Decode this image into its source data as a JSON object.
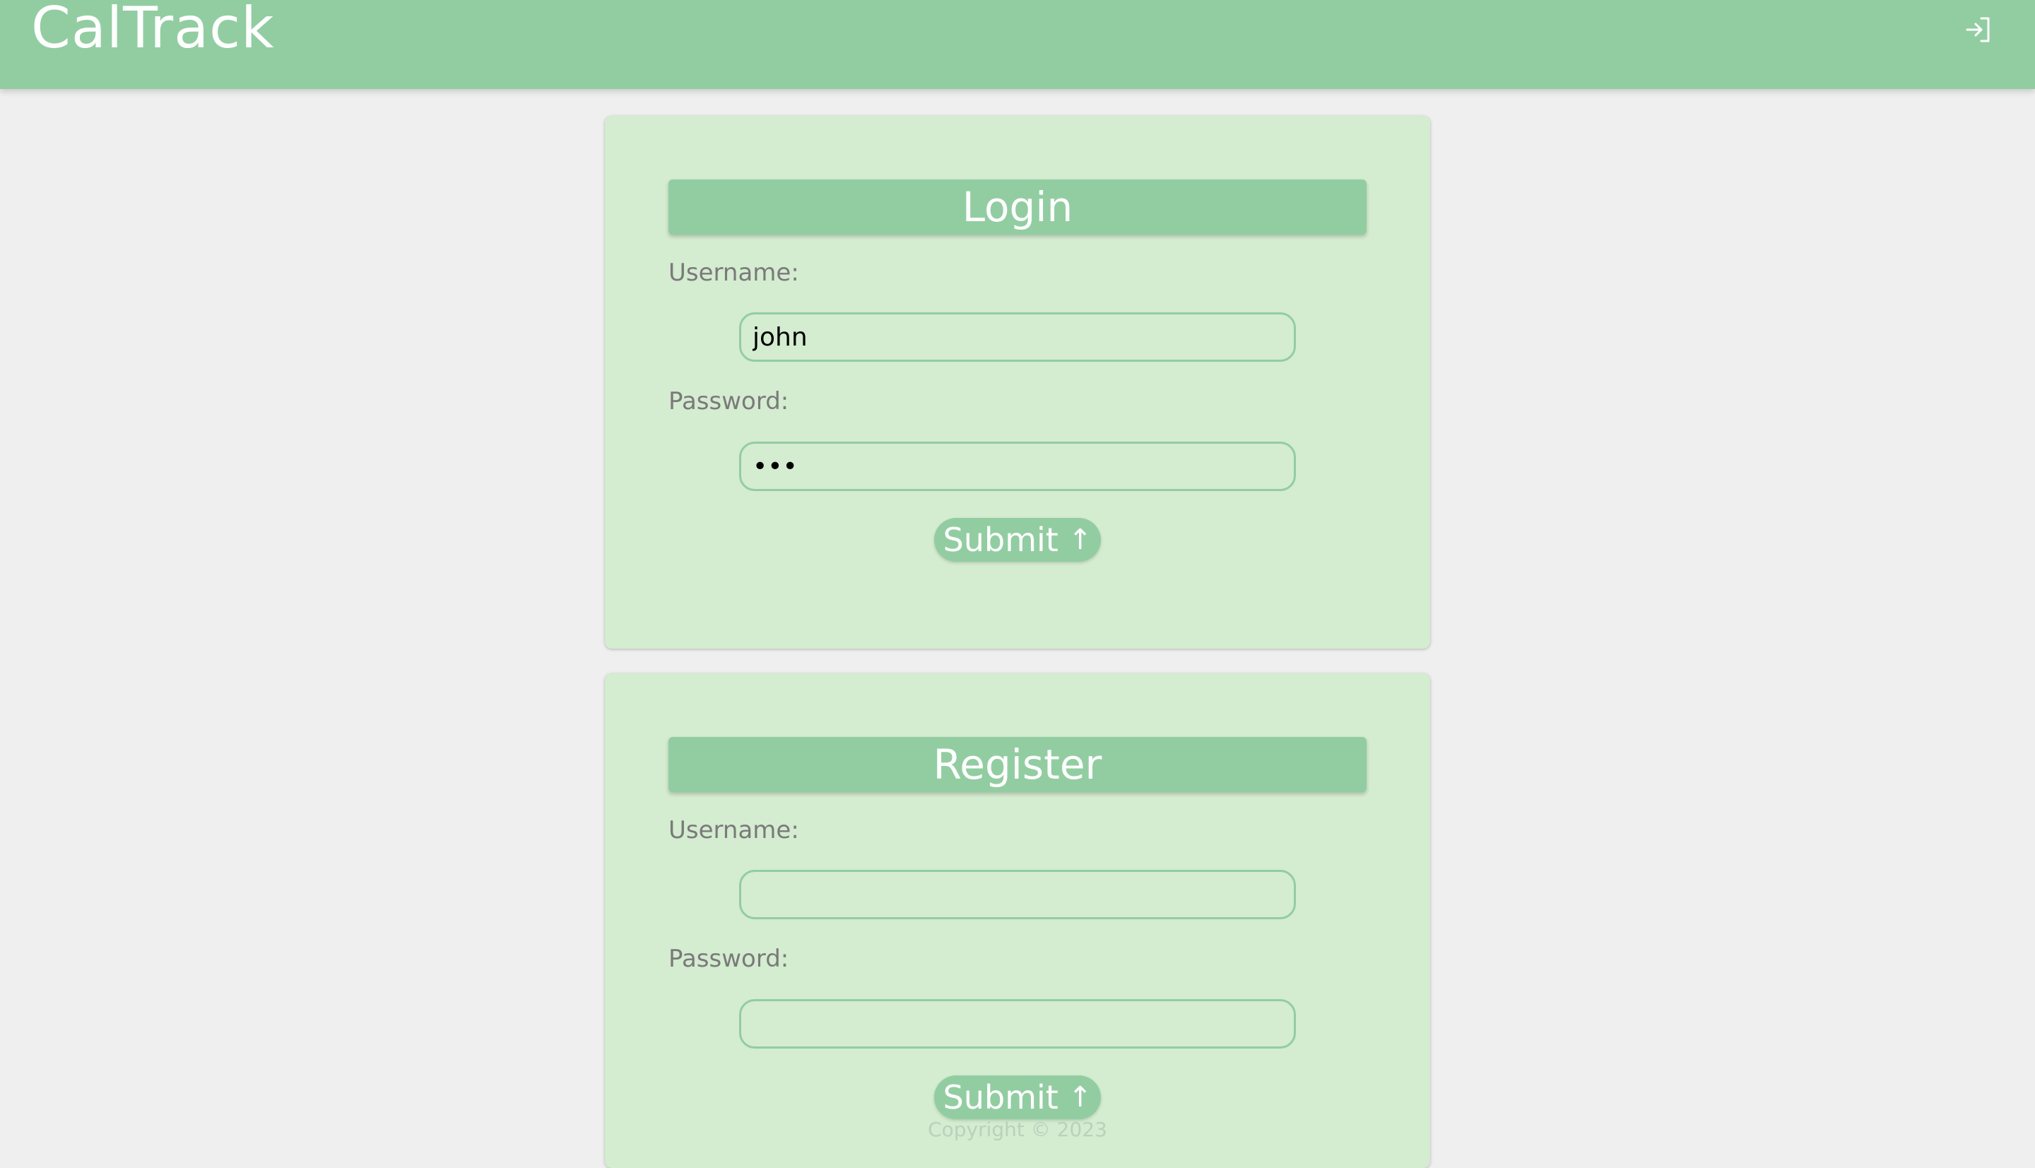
{
  "header": {
    "brand": "CalTrack",
    "login_icon": "sign-in-icon"
  },
  "login": {
    "title": "Login",
    "username_label": "Username:",
    "username_value": "john",
    "password_label": "Password:",
    "password_value": "•••",
    "submit_label": "Submit",
    "submit_icon": "↑"
  },
  "register": {
    "title": "Register",
    "username_label": "Username:",
    "username_value": "",
    "password_label": "Password:",
    "password_value": "",
    "submit_label": "Submit",
    "submit_icon": "↑"
  },
  "footer": {
    "copyright": "Copyright © 2023"
  },
  "colors": {
    "accent": "#92cda2",
    "card": "#d4ecd0",
    "background": "#efefef"
  }
}
